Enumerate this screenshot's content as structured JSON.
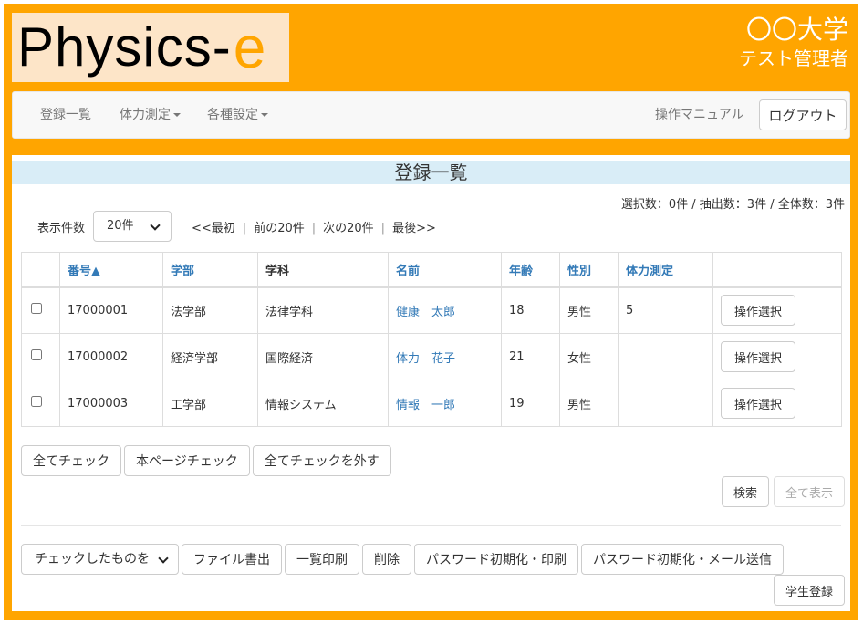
{
  "header": {
    "logo_main": "Physics-",
    "logo_accent": "e",
    "university": "〇〇大学",
    "role": "テスト管理者"
  },
  "nav": {
    "items": [
      {
        "label": "登録一覧",
        "dropdown": false
      },
      {
        "label": "体力測定",
        "dropdown": true
      },
      {
        "label": "各種設定",
        "dropdown": true
      }
    ],
    "manual": "操作マニュアル",
    "logout": "ログアウト"
  },
  "panel": {
    "title": "登録一覧",
    "counts": "選択数：0件 / 抽出数：3件 / 全体数：3件",
    "per_page_label": "表示件数",
    "per_page_value": "20件",
    "pager": {
      "first": "<<最初",
      "prev": "前の20件",
      "next": "次の20件",
      "last": "最後>>"
    }
  },
  "table": {
    "columns": [
      "",
      "番号▲",
      "学部",
      "学科",
      "名前",
      "年齢",
      "性別",
      "体力測定",
      ""
    ],
    "rows": [
      {
        "id": "17000001",
        "faculty": "法学部",
        "dept": "法律学科",
        "name": "健康　太郎",
        "age": "18",
        "gender": "男性",
        "fitness": "5",
        "op": "操作選択"
      },
      {
        "id": "17000002",
        "faculty": "経済学部",
        "dept": "国際経済",
        "name": "体力　花子",
        "age": "21",
        "gender": "女性",
        "fitness": "",
        "op": "操作選択"
      },
      {
        "id": "17000003",
        "faculty": "工学部",
        "dept": "情報システム",
        "name": "情報　一郎",
        "age": "19",
        "gender": "男性",
        "fitness": "",
        "op": "操作選択"
      }
    ]
  },
  "actions": {
    "check_all": "全てチェック",
    "check_page": "本ページチェック",
    "uncheck_all": "全てチェックを外す",
    "search": "検索",
    "show_all": "全て表示",
    "bulk_select": "チェックしたものを",
    "export": "ファイル書出",
    "print_list": "一覧印刷",
    "delete": "削除",
    "pw_print": "パスワード初期化・印刷",
    "pw_mail": "パスワード初期化・メール送信",
    "register": "学生登録"
  },
  "colors": {
    "frame": "#ffa500",
    "logo_bg": "#fde5c8",
    "title_bg": "#d9edf7",
    "link": "#337ab7"
  }
}
